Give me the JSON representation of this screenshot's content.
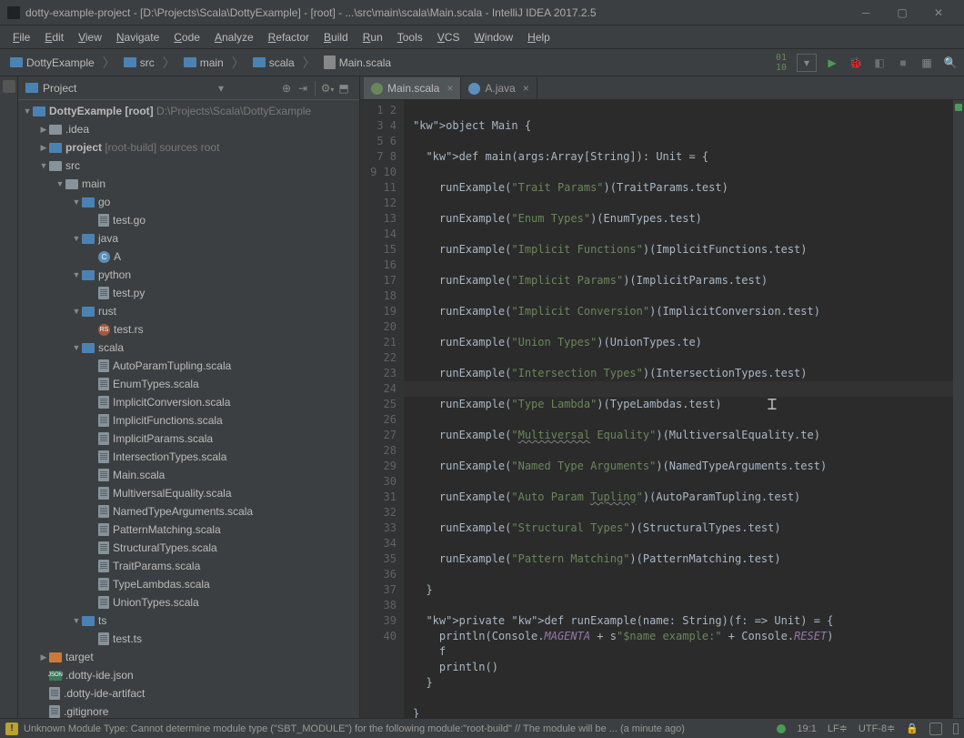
{
  "window": {
    "title": "dotty-example-project - [D:\\Projects\\Scala\\DottyExample] - [root] - ...\\src\\main\\scala\\Main.scala - IntelliJ IDEA 2017.2.5"
  },
  "menu": {
    "items": [
      "File",
      "Edit",
      "View",
      "Navigate",
      "Code",
      "Analyze",
      "Refactor",
      "Build",
      "Run",
      "Tools",
      "VCS",
      "Window",
      "Help"
    ]
  },
  "breadcrumbs": [
    {
      "label": "DottyExample",
      "icon": "folder-blue"
    },
    {
      "label": "src",
      "icon": "folder-blue"
    },
    {
      "label": "main",
      "icon": "folder-blue"
    },
    {
      "label": "scala",
      "icon": "folder-blue"
    },
    {
      "label": "Main.scala",
      "icon": "file"
    }
  ],
  "project_panel": {
    "title": "Project"
  },
  "tree": [
    {
      "depth": 0,
      "arrow": "open",
      "icon": "folder-blue",
      "label": "DottyExample",
      "suffix": " [root]  D:\\Projects\\Scala\\DottyExample",
      "bold": true
    },
    {
      "depth": 1,
      "arrow": "closed",
      "icon": "folder",
      "label": ".idea"
    },
    {
      "depth": 1,
      "arrow": "closed",
      "icon": "folder-blue",
      "label": "project",
      "suffix": " [root-build]  sources root",
      "bold": true,
      "suffixdim": true
    },
    {
      "depth": 1,
      "arrow": "open",
      "icon": "folder",
      "label": "src"
    },
    {
      "depth": 2,
      "arrow": "open",
      "icon": "folder",
      "label": "main"
    },
    {
      "depth": 3,
      "arrow": "open",
      "icon": "folder-blue",
      "label": "go"
    },
    {
      "depth": 4,
      "arrow": "none",
      "icon": "file",
      "label": "test.go"
    },
    {
      "depth": 3,
      "arrow": "open",
      "icon": "folder-blue",
      "label": "java"
    },
    {
      "depth": 4,
      "arrow": "none",
      "icon": "file-java",
      "iconText": "C",
      "label": "A"
    },
    {
      "depth": 3,
      "arrow": "open",
      "icon": "folder-blue",
      "label": "python"
    },
    {
      "depth": 4,
      "arrow": "none",
      "icon": "file",
      "label": "test.py"
    },
    {
      "depth": 3,
      "arrow": "open",
      "icon": "folder-blue",
      "label": "rust"
    },
    {
      "depth": 4,
      "arrow": "none",
      "icon": "file-rs",
      "iconText": "RS",
      "label": "test.rs"
    },
    {
      "depth": 3,
      "arrow": "open",
      "icon": "folder-blue",
      "label": "scala"
    },
    {
      "depth": 4,
      "arrow": "none",
      "icon": "file",
      "label": "AutoParamTupling.scala"
    },
    {
      "depth": 4,
      "arrow": "none",
      "icon": "file",
      "label": "EnumTypes.scala"
    },
    {
      "depth": 4,
      "arrow": "none",
      "icon": "file",
      "label": "ImplicitConversion.scala"
    },
    {
      "depth": 4,
      "arrow": "none",
      "icon": "file",
      "label": "ImplicitFunctions.scala"
    },
    {
      "depth": 4,
      "arrow": "none",
      "icon": "file",
      "label": "ImplicitParams.scala"
    },
    {
      "depth": 4,
      "arrow": "none",
      "icon": "file",
      "label": "IntersectionTypes.scala"
    },
    {
      "depth": 4,
      "arrow": "none",
      "icon": "file",
      "label": "Main.scala"
    },
    {
      "depth": 4,
      "arrow": "none",
      "icon": "file",
      "label": "MultiversalEquality.scala"
    },
    {
      "depth": 4,
      "arrow": "none",
      "icon": "file",
      "label": "NamedTypeArguments.scala"
    },
    {
      "depth": 4,
      "arrow": "none",
      "icon": "file",
      "label": "PatternMatching.scala"
    },
    {
      "depth": 4,
      "arrow": "none",
      "icon": "file",
      "label": "StructuralTypes.scala"
    },
    {
      "depth": 4,
      "arrow": "none",
      "icon": "file",
      "label": "TraitParams.scala"
    },
    {
      "depth": 4,
      "arrow": "none",
      "icon": "file",
      "label": "TypeLambdas.scala"
    },
    {
      "depth": 4,
      "arrow": "none",
      "icon": "file",
      "label": "UnionTypes.scala"
    },
    {
      "depth": 3,
      "arrow": "open",
      "icon": "folder-blue",
      "label": "ts"
    },
    {
      "depth": 4,
      "arrow": "none",
      "icon": "file",
      "label": "test.ts"
    },
    {
      "depth": 1,
      "arrow": "closed",
      "icon": "folder-orange",
      "label": "target"
    },
    {
      "depth": 1,
      "arrow": "none",
      "icon": "file-json",
      "iconText": "JSON",
      "label": ".dotty-ide.json"
    },
    {
      "depth": 1,
      "arrow": "none",
      "icon": "file",
      "label": ".dotty-ide-artifact"
    },
    {
      "depth": 1,
      "arrow": "none",
      "icon": "file",
      "label": ".gitignore"
    }
  ],
  "tabs": [
    {
      "label": "Main.scala",
      "icon": "sc",
      "active": true
    },
    {
      "label": "A.java",
      "icon": "jv",
      "active": false
    }
  ],
  "code": {
    "lines": 40,
    "src": "\nobject Main {\n\n  def main(args:Array[String]): Unit = {\n\n    runExample(\"Trait Params\")(TraitParams.test)\n\n    runExample(\"Enum Types\")(EnumTypes.test)\n\n    runExample(\"Implicit Functions\")(ImplicitFunctions.test)\n\n    runExample(\"Implicit Params\")(ImplicitParams.test)\n\n    runExample(\"Implicit Conversion\")(ImplicitConversion.test)\n\n    runExample(\"Union Types\")(UnionTypes.te)\n\n    runExample(\"Intersection Types\")(IntersectionTypes.test)\n\n    runExample(\"Type Lambda\")(TypeLambdas.test)\n\n    runExample(\"Multiversal Equality\")(MultiversalEquality.te)\n\n    runExample(\"Named Type Arguments\")(NamedTypeArguments.test)\n\n    runExample(\"Auto Param Tupling\")(AutoParamTupling.test)\n\n    runExample(\"Structural Types\")(StructuralTypes.test)\n\n    runExample(\"Pattern Matching\")(PatternMatching.test)\n\n  }\n\n  private def runExample(name: String)(f: => Unit) = {\n    println(Console.MAGENTA + s\"$name example:\" + Console.RESET)\n    f\n    println()\n  }\n\n}"
  },
  "status": {
    "warn_icon": "!",
    "message": "Unknown Module Type: Cannot determine module type (\"SBT_MODULE\") for the following module:\"root-build\" // The module will be ... (a minute ago)",
    "pos": "19:1",
    "le": "LF≑",
    "enc": "UTF-8≑"
  }
}
